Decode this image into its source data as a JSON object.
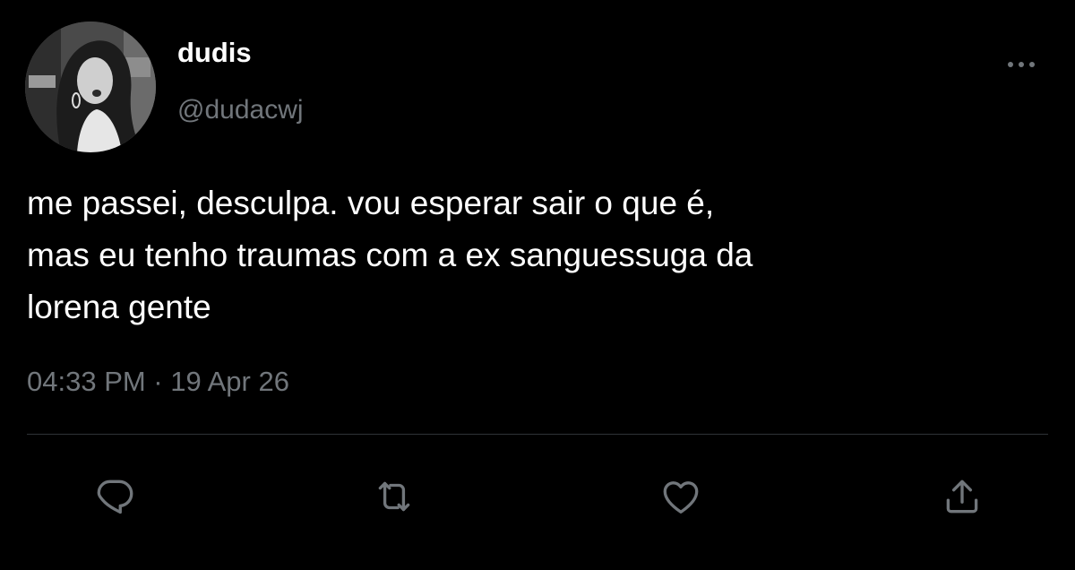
{
  "tweet": {
    "display_name": "dudis",
    "handle": "@dudacwj",
    "text": "me passei, desculpa. vou esperar sair o que é,\nmas eu tenho traumas com a ex sanguessuga da\nlorena gente",
    "timestamp": "04:33 PM · 19 Apr 26"
  },
  "icons": {
    "more": "more-horizontal-icon",
    "reply": "reply-icon",
    "retweet": "retweet-icon",
    "like": "heart-icon",
    "share": "share-icon"
  },
  "colors": {
    "background": "#000000",
    "text": "#ffffff",
    "secondary_text": "#71767b",
    "divider": "#2f3336"
  }
}
